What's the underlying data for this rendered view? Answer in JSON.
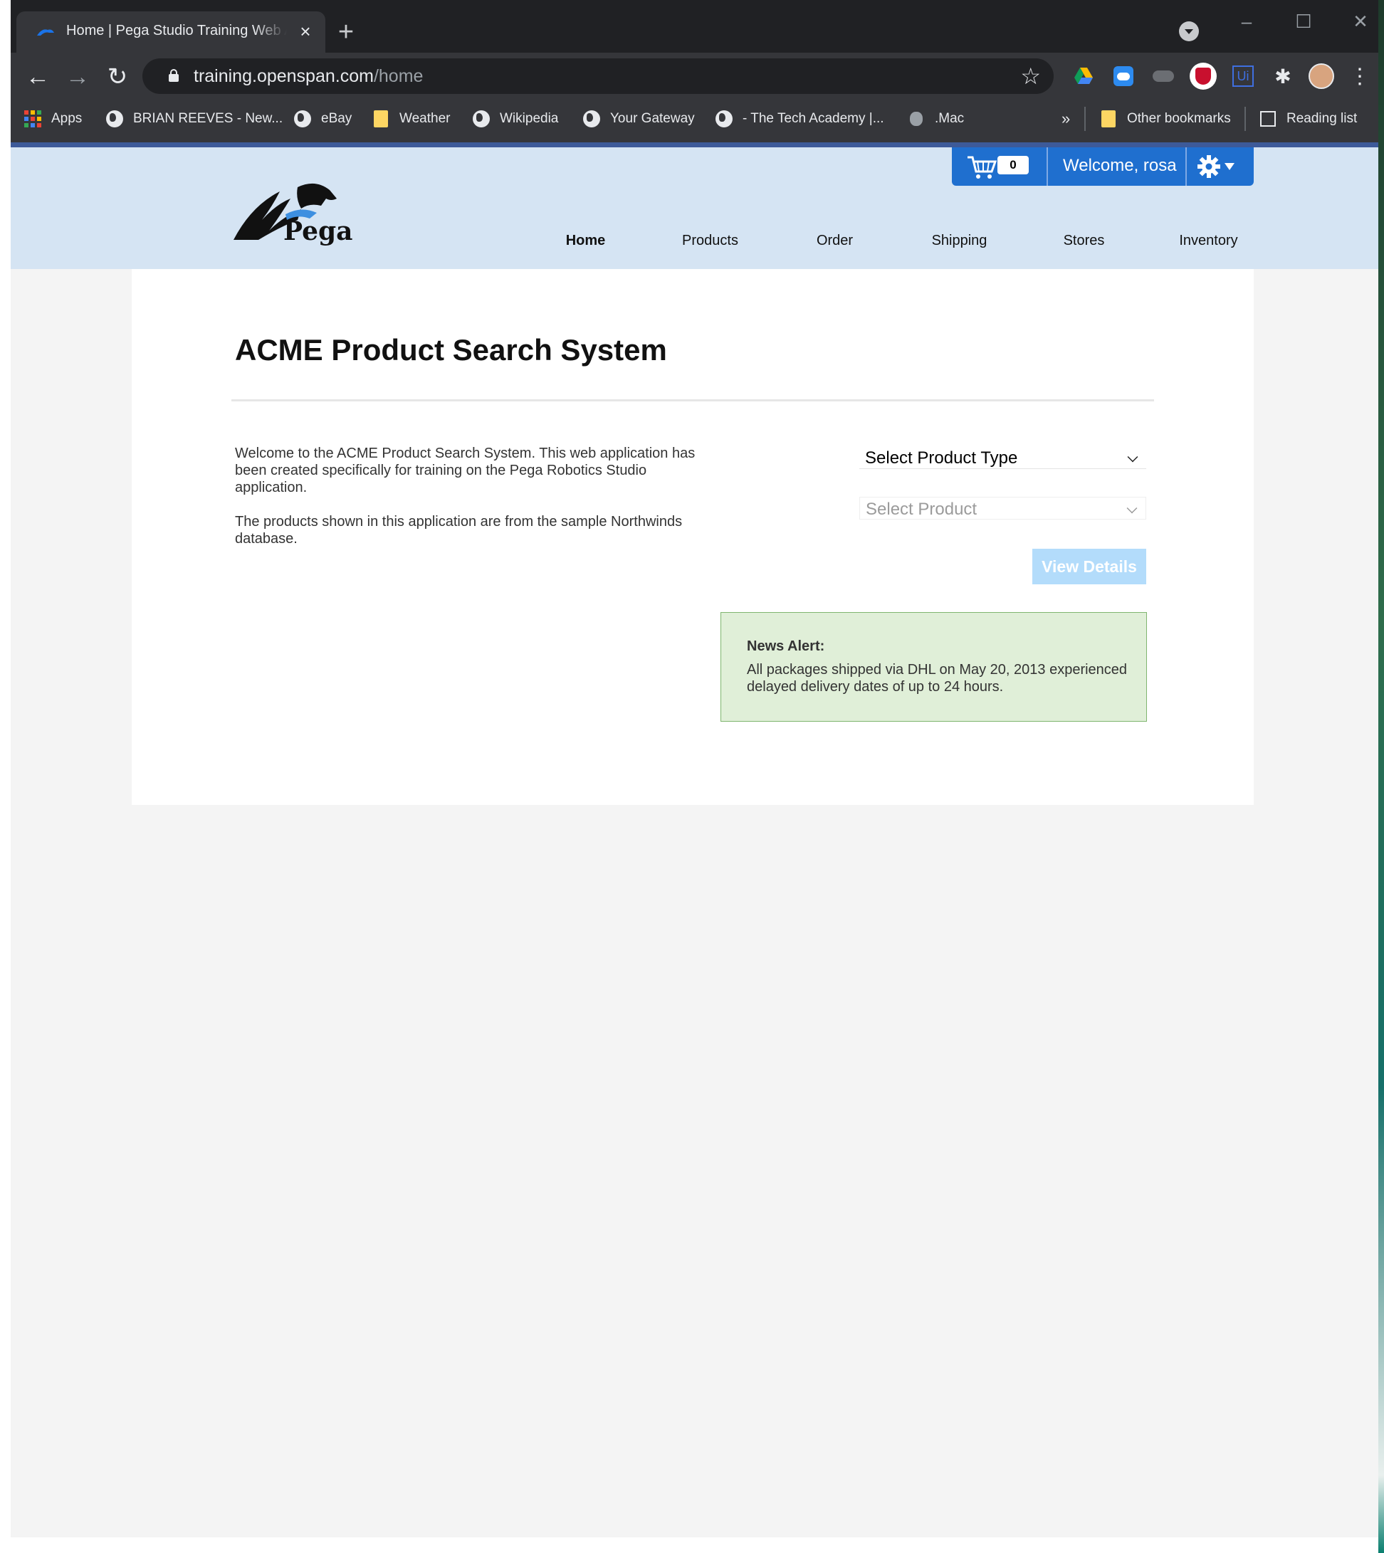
{
  "browser": {
    "tab_title": "Home | Pega Studio Training Web Application",
    "new_tab_icon": "plus-icon",
    "url_host": "training.openspan.com",
    "url_path": "/home",
    "bookmarks": [
      {
        "label": "Apps",
        "icon": "apps-grid-icon"
      },
      {
        "label": "BRIAN REEVES - New...",
        "icon": "globe-icon"
      },
      {
        "label": "eBay",
        "icon": "globe-icon"
      },
      {
        "label": "Weather",
        "icon": "folder-icon"
      },
      {
        "label": "Wikipedia",
        "icon": "globe-icon"
      },
      {
        "label": "Your Gateway",
        "icon": "globe-icon"
      },
      {
        "label": "- The Tech Academy |...",
        "icon": "globe-icon"
      },
      {
        "label": ".Mac",
        "icon": "apple-icon"
      }
    ],
    "overflow_label": "»",
    "other_bookmarks": "Other bookmarks",
    "reading_list": "Reading list"
  },
  "site": {
    "logo_text": "Pega",
    "cart_count": "0",
    "welcome": "Welcome, rosa",
    "nav": [
      {
        "label": "Home",
        "active": true
      },
      {
        "label": "Products"
      },
      {
        "label": "Order"
      },
      {
        "label": "Shipping"
      },
      {
        "label": "Stores"
      },
      {
        "label": "Inventory"
      }
    ],
    "colors": {
      "header_bg": "#d5e4f3",
      "accent_blue": "#1f6fcf",
      "alert_bg": "#e0efd8",
      "button_disabled": "#b3dcfb"
    }
  },
  "main": {
    "title": "ACME Product Search System",
    "intro_1": "Welcome to the ACME Product Search System. This web application has been created specifically for training on the Pega Robotics Studio application.",
    "intro_2": "The products shown in this application are from the sample Northwinds database.",
    "product_type_select": "Select Product Type",
    "product_select": "Select Product",
    "view_details": "View Details",
    "news_title": "News Alert:",
    "news_text": "All packages shipped via DHL on May 20, 2013 experienced delayed delivery dates of up to 24 hours."
  }
}
